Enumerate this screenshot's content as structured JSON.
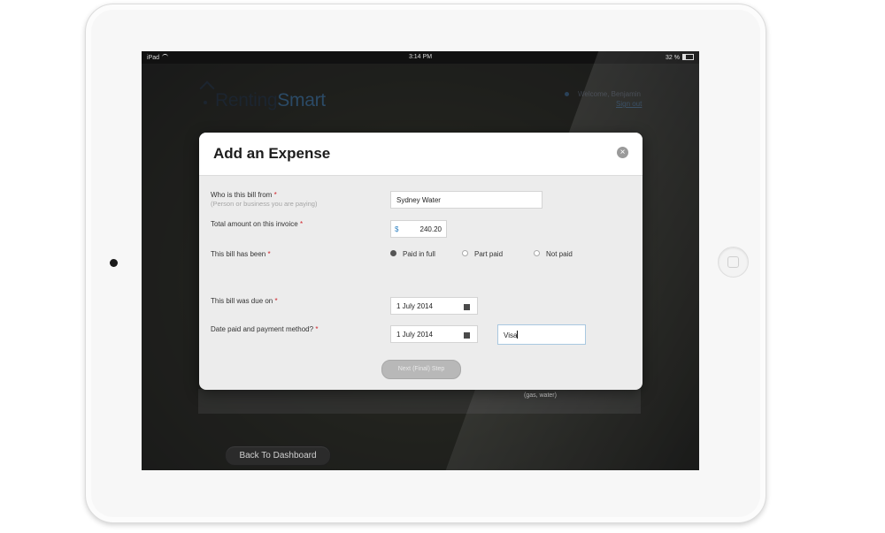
{
  "status_bar": {
    "device": "iPad",
    "time": "3:14 PM",
    "battery": "32 %"
  },
  "app": {
    "logo_main": "Renting",
    "logo_accent": "Smart",
    "welcome": "Welcome, Benjamin",
    "sign_out": "Sign out",
    "back_button": "Back To Dashboard",
    "background_note": "(gas, water)"
  },
  "modal": {
    "title": "Add an Expense",
    "fields": {
      "bill_from": {
        "label": "Who is this bill from",
        "sublabel": "(Person or business you are paying)",
        "value": "Sydney Water"
      },
      "total_amount": {
        "label": "Total amount on this invoice",
        "currency": "$",
        "value": "240.20"
      },
      "bill_status": {
        "label": "This bill has been",
        "options": [
          "Paid in full",
          "Part paid",
          "Not paid"
        ],
        "selected": "Paid in full"
      },
      "due_date": {
        "label": "This bill was due on",
        "value": "1 July 2014"
      },
      "date_paid": {
        "label": "Date paid and payment method?",
        "date_value": "1 July 2014",
        "method_value": "Visa"
      }
    },
    "next_button": "Next (Final) Step"
  },
  "colors": {
    "required": "#d0232a",
    "accent": "#2c7fc0"
  }
}
